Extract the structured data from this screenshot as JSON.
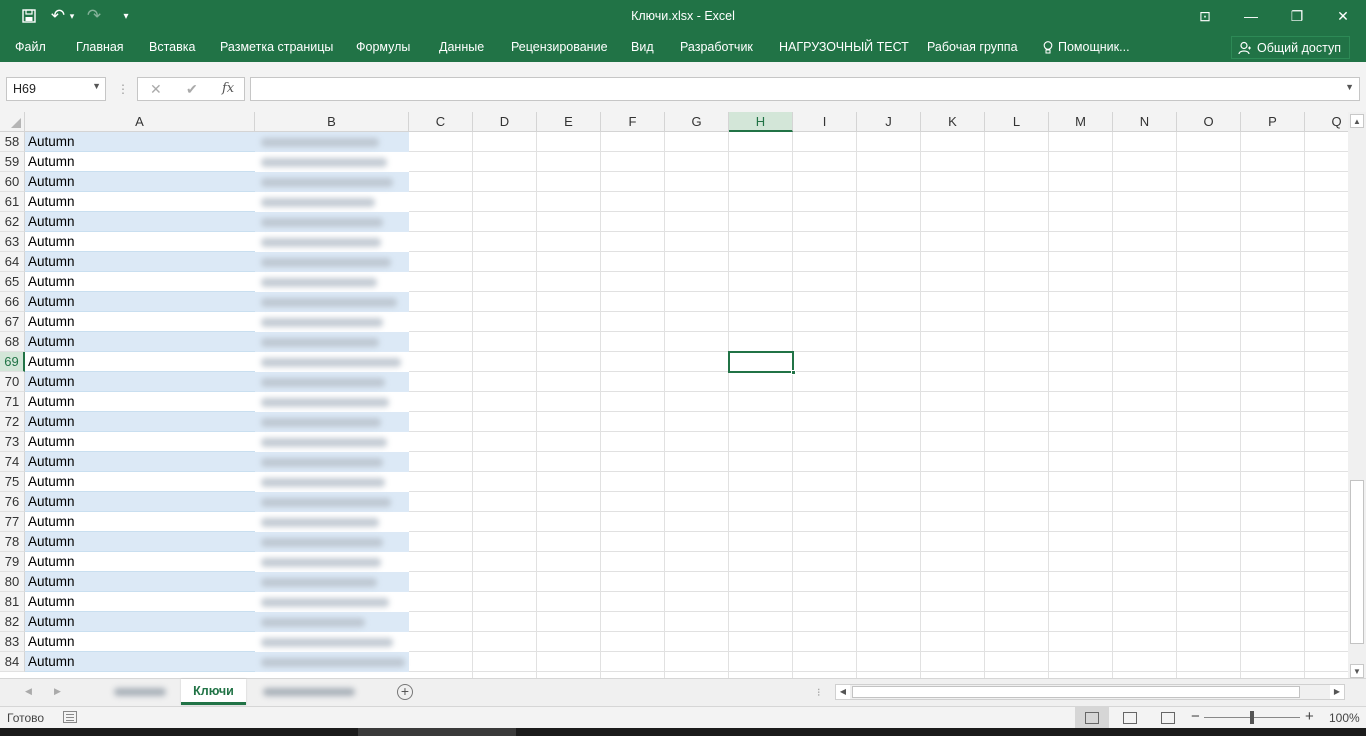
{
  "window": {
    "title": "Ключи.xlsx - Excel",
    "qa_save": "💾",
    "qa_undo": "↶",
    "qa_undo_arrow": "▾",
    "qa_redo": "↷",
    "qa_customize": "▾",
    "ribbon_display": "⊡",
    "minimize": "—",
    "restore": "❐",
    "close": "✕"
  },
  "ribbon": {
    "tabs": [
      "Файл",
      "Главная",
      "Вставка",
      "Разметка страницы",
      "Формулы",
      "Данные",
      "Рецензирование",
      "Вид",
      "Разработчик",
      "НАГРУЗОЧНЫЙ ТЕСТ",
      "Рабочая группа"
    ],
    "tell_me": "Помощник...",
    "share": "Общий доступ"
  },
  "formula_bar": {
    "name_box": "H69",
    "cancel": "✕",
    "enter": "✔",
    "fx": "fx",
    "value": ""
  },
  "grid": {
    "columns": [
      "A",
      "B",
      "C",
      "D",
      "E",
      "F",
      "G",
      "H",
      "I",
      "J",
      "K",
      "L",
      "M",
      "N",
      "O",
      "P",
      "Q"
    ],
    "selected_column": "H",
    "selected_row": "69",
    "rows": [
      {
        "n": "58",
        "a": "Autumn"
      },
      {
        "n": "59",
        "a": "Autumn"
      },
      {
        "n": "60",
        "a": "Autumn"
      },
      {
        "n": "61",
        "a": "Autumn"
      },
      {
        "n": "62",
        "a": "Autumn"
      },
      {
        "n": "63",
        "a": "Autumn"
      },
      {
        "n": "64",
        "a": "Autumn"
      },
      {
        "n": "65",
        "a": "Autumn"
      },
      {
        "n": "66",
        "a": "Autumn"
      },
      {
        "n": "67",
        "a": "Autumn"
      },
      {
        "n": "68",
        "a": "Autumn"
      },
      {
        "n": "69",
        "a": "Autumn"
      },
      {
        "n": "70",
        "a": "Autumn"
      },
      {
        "n": "71",
        "a": "Autumn"
      },
      {
        "n": "72",
        "a": "Autumn"
      },
      {
        "n": "73",
        "a": "Autumn"
      },
      {
        "n": "74",
        "a": "Autumn"
      },
      {
        "n": "75",
        "a": "Autumn"
      },
      {
        "n": "76",
        "a": "Autumn"
      },
      {
        "n": "77",
        "a": "Autumn"
      },
      {
        "n": "78",
        "a": "Autumn"
      },
      {
        "n": "79",
        "a": "Autumn"
      },
      {
        "n": "80",
        "a": "Autumn"
      },
      {
        "n": "81",
        "a": "Autumn"
      },
      {
        "n": "82",
        "a": "Autumn"
      },
      {
        "n": "83",
        "a": "Autumn"
      },
      {
        "n": "84",
        "a": "Autumn"
      }
    ]
  },
  "sheets": {
    "active": "Ключи",
    "add": "+",
    "split": "⁝"
  },
  "status": {
    "ready": "Готово",
    "zoom": "100%",
    "zoom_minus": "−",
    "zoom_plus": "+"
  },
  "icons": {
    "user": "user-icon",
    "lightbulb": "lightbulb-icon",
    "save": "save-icon",
    "undo": "undo-icon",
    "redo": "redo-icon"
  },
  "colors": {
    "accent": "#217346",
    "table_band": "#dce9f6"
  }
}
